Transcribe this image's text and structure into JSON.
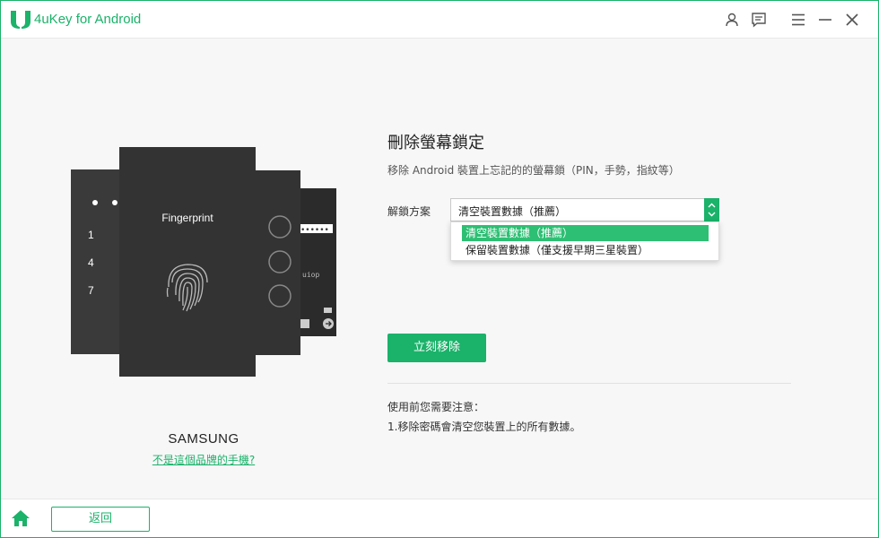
{
  "app": {
    "title": "4uKey for Android",
    "brand_color": "#1bb26a"
  },
  "titlebar": {
    "icons": [
      "user-icon",
      "feedback-icon",
      "menu-icon",
      "minimize-icon",
      "close-icon"
    ]
  },
  "illustration": {
    "phone_front_label": "Fingerprint",
    "keypad_digits": [
      "1",
      "4",
      "7"
    ],
    "keyboard_hint": "uiop",
    "password_mask": "••••••",
    "brand_name": "SAMSUNG",
    "brand_link": "不是這個品牌的手機?"
  },
  "panel": {
    "heading": "刪除螢幕鎖定",
    "subtitle": "移除 Android 裝置上忘記的的螢幕鎖（PIN，手勢，指紋等）",
    "scheme_label": "解鎖方案",
    "select_value": "清空裝置數據（推薦）",
    "options": [
      "清空裝置數據（推薦）",
      "保留裝置數據（僅支援早期三星裝置）"
    ],
    "action_button": "立刻移除",
    "note_title": "使用前您需要注意：",
    "note_item": "1.移除密碼會清空您裝置上的所有數據。"
  },
  "footer": {
    "back_label": "返回"
  }
}
